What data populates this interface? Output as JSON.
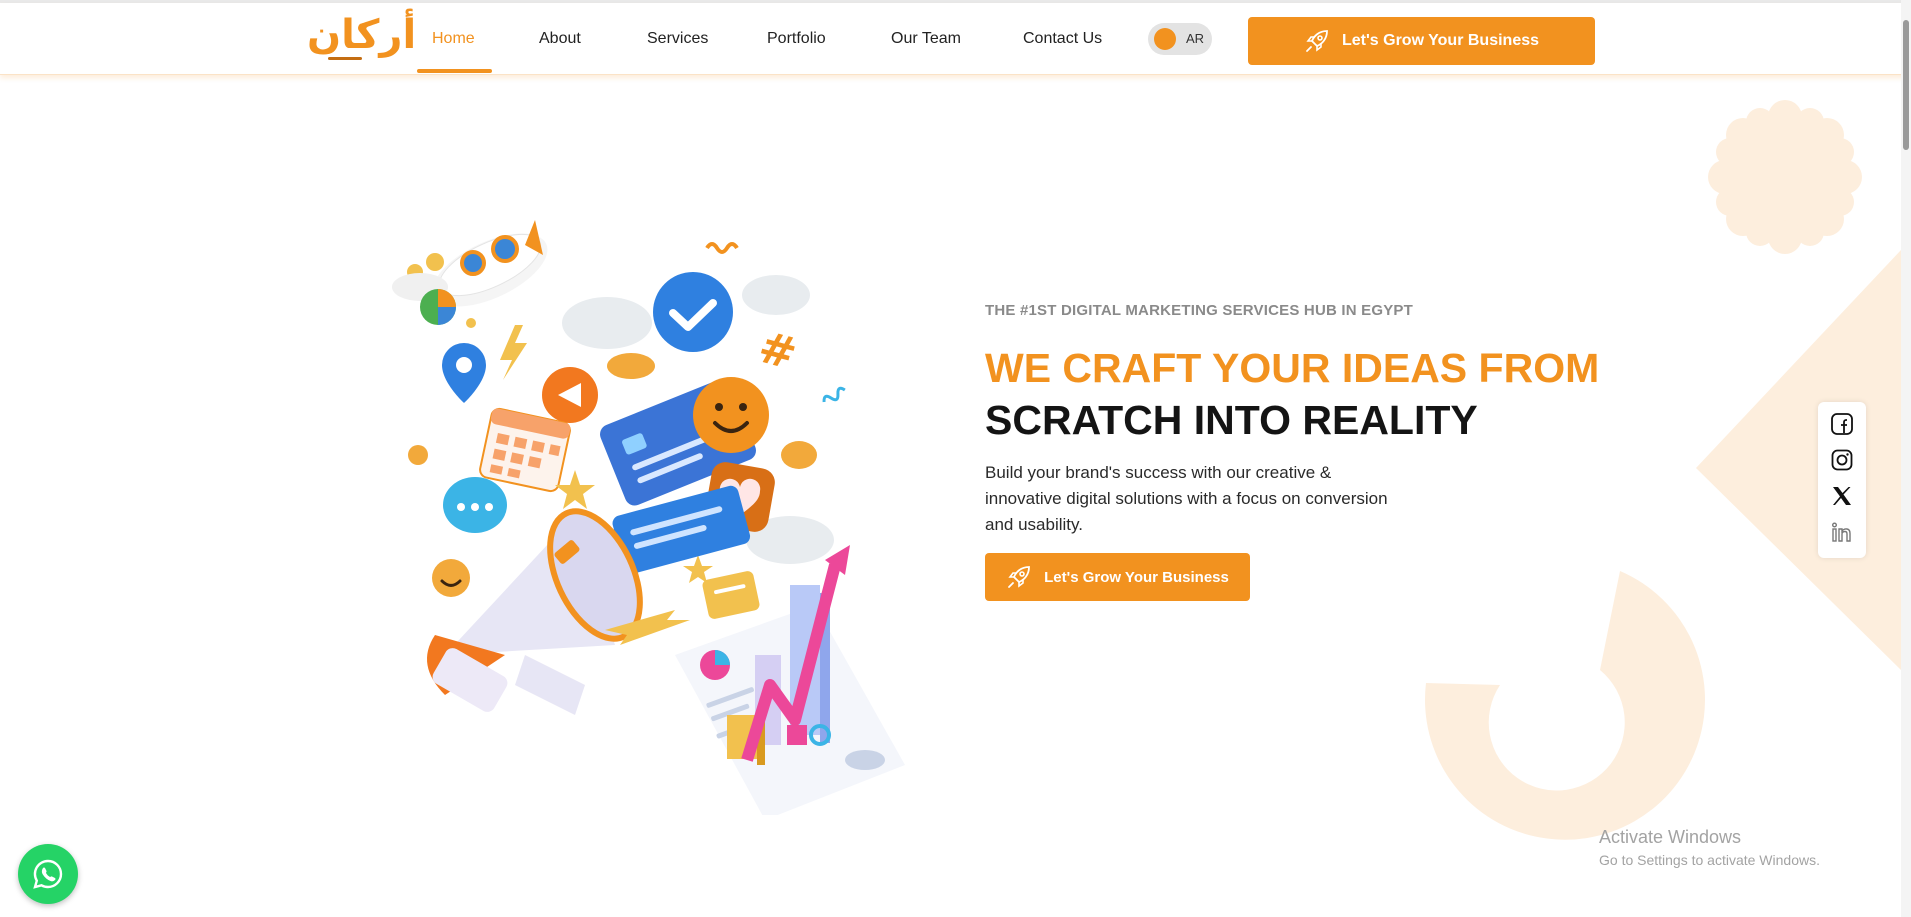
{
  "nav": {
    "logo_text": "أركان",
    "items": [
      {
        "label": "Home",
        "active": true
      },
      {
        "label": "About"
      },
      {
        "label": "Services"
      },
      {
        "label": "Portfolio"
      },
      {
        "label": "Our Team"
      },
      {
        "label": "Contact Us"
      }
    ],
    "lang_toggle": "AR",
    "cta": "Let's Grow Your Business"
  },
  "hero": {
    "eyebrow": "THE #1ST DIGITAL MARKETING SERVICES HUB IN EGYPT",
    "headline_line1": "WE CRAFT YOUR IDEAS FROM",
    "headline_line2": "SCRATCH INTO REALITY",
    "description": "Build your brand's success with our creative & innovative digital solutions with a focus on conversion and usability.",
    "cta": "Let's Grow Your Business"
  },
  "social": [
    "facebook-icon",
    "instagram-icon",
    "x-icon",
    "linkedin-icon"
  ],
  "watermark": {
    "title": "Activate Windows",
    "subtitle": "Go to Settings to activate Windows."
  },
  "colors": {
    "accent": "#f2921f",
    "dark": "#141414",
    "muted": "#8a8a8a",
    "deco": "#fdeedd",
    "whatsapp": "#25d366"
  }
}
